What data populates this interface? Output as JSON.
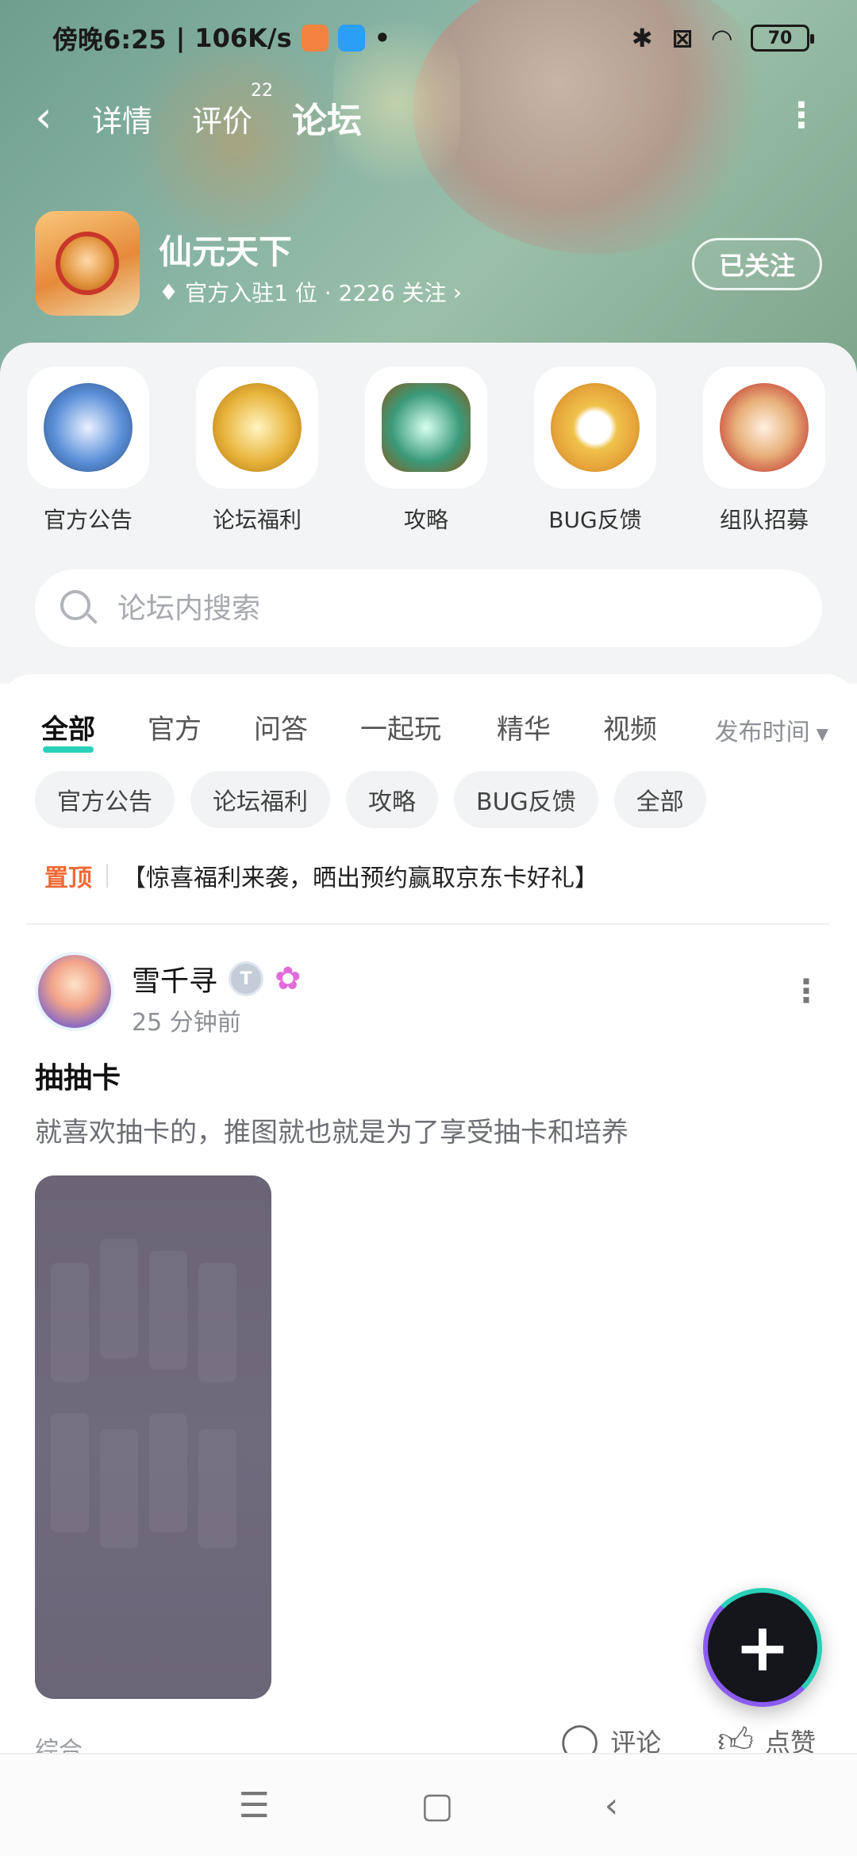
{
  "statusbar": {
    "time": "傍晚6:25",
    "speed": "106K/s",
    "battery": "70"
  },
  "nav": {
    "back_icon": "chevron-left-icon",
    "tabs": [
      {
        "label": "详情"
      },
      {
        "label": "评价",
        "count": "22"
      },
      {
        "label": "论坛",
        "active": true
      }
    ],
    "more_icon": "more-vertical-icon"
  },
  "game": {
    "name": "仙元天下",
    "meta": "官方入驻1 位 · 2226 关注",
    "follow_label": "已关注"
  },
  "categories": [
    {
      "label": "官方公告",
      "color": "#5a8fd8"
    },
    {
      "label": "论坛福利",
      "color": "#e8b33a"
    },
    {
      "label": "攻略",
      "color": "#3a9a7a"
    },
    {
      "label": "BUG反馈",
      "color": "#e5a43a"
    },
    {
      "label": "组队招募",
      "color": "#c9503e"
    }
  ],
  "search": {
    "placeholder": "论坛内搜索"
  },
  "feed": {
    "tabs": [
      {
        "label": "全部",
        "active": true
      },
      {
        "label": "官方"
      },
      {
        "label": "问答"
      },
      {
        "label": "一起玩"
      },
      {
        "label": "精华"
      },
      {
        "label": "视频"
      }
    ],
    "sort_label": "发布时间",
    "chips": [
      "官方公告",
      "论坛福利",
      "攻略",
      "BUG反馈",
      "全部"
    ],
    "pinned": {
      "tag": "置顶",
      "text": "【惊喜福利来袭，晒出预约赢取京东卡好礼】"
    }
  },
  "post": {
    "username": "雪千寻",
    "level_badge": "T",
    "time_ago": "25 分钟前",
    "title": "抽抽卡",
    "body": "就喜欢抽卡的，推图就也就是为了享受抽卡和培养",
    "category": "综合",
    "comment_label": "评论",
    "like_label": "点赞"
  },
  "colors": {
    "accent": "#2ad0b8",
    "pin": "#f06b36"
  }
}
